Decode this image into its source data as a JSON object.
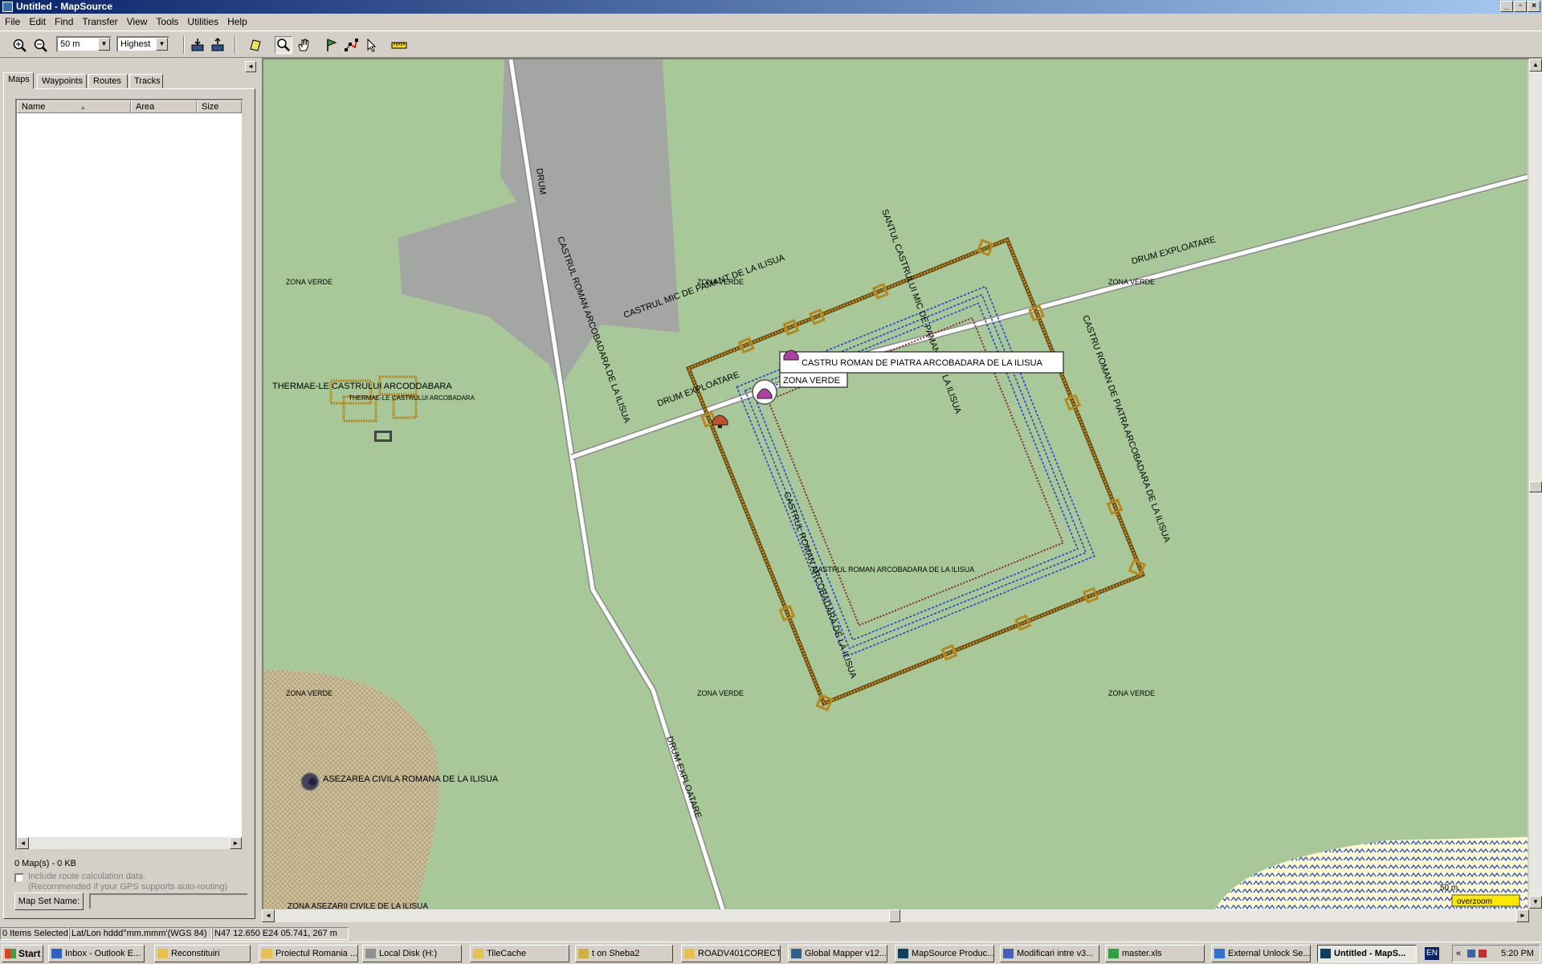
{
  "window": {
    "title": "Untitled - MapSource"
  },
  "menu": [
    "File",
    "Edit",
    "Find",
    "Transfer",
    "View",
    "Tools",
    "Utilities",
    "Help"
  ],
  "toolbar": {
    "zoom_value": "50 m",
    "detail_value": "Highest"
  },
  "sidebar": {
    "tabs": [
      "Maps",
      "Waypoints",
      "Routes",
      "Tracks"
    ],
    "columns": [
      "Name",
      "Area",
      "Size"
    ],
    "map_count": "0 Map(s) - 0 KB",
    "route_calc_label": "Include route calculation data.",
    "route_calc_note": "(Recommended if your GPS supports auto-routing)",
    "map_set_button": "Map Set Name:"
  },
  "map": {
    "road_labels": {
      "drum": "DRUM",
      "drum_exploatare": "DRUM EXPLOATARE"
    },
    "zone_label": "ZONA VERDE",
    "labels": {
      "castru_pamant": "CASTRUL MIC DE PAMANT DE LA ILISUA",
      "castru_roman": "CASTRUL ROMAN ARCOBADARA DE LA ILISUA",
      "castru_roman_small": "CASTRUL ROMAN ARCOBADARA DE LA ILISUA",
      "santul": "SANTUL CASTRULUI MIC DE PAMANT DE LA ILISUA",
      "castru_piatra": "CASTRU ROMAN DE PIATRA ARCOBADARA DE LA ILISUA",
      "thermae": "THERMAE-LE CASTRULUI ARCODDABARA",
      "thermae_small": "THERMAE-LE CASTRULUI ARCOBADARA",
      "asezarea": "ASEZAREA CIVILA ROMANA DE LA ILISUA",
      "asezarea_bottom": "ZONA ASEZARII CIVILE DE LA ILISUA"
    },
    "tooltip": {
      "title": "CASTRU ROMAN DE PIATRA ARCOBADARA DE LA ILISUA",
      "subtitle": "ZONA VERDE"
    },
    "scale": {
      "label": "50 m",
      "overzoom": "overzoom"
    },
    "colors": {
      "land": "#a8c89a",
      "building": "#a3a6a3",
      "road_fill": "#ffffff",
      "road_casing": "#8a8a8a",
      "wall": "#b5891f",
      "trench": "#2244cc",
      "earthwork": "#8a2a2a"
    }
  },
  "status": {
    "selected": "0 Items Selected",
    "format": "Lat/Lon hddd°mm.mmm'(WGS 84)",
    "coords": "N47 12.650 E24 05.741, 267 m"
  },
  "taskbar": {
    "start": "Start",
    "tasks": [
      "Inbox - Outlook E...",
      "Reconstituiri",
      "Proiectul Romania ...",
      "Local Disk (H:)",
      "TileCache",
      "t on Sheba2",
      "ROADV401CORECT",
      "Global Mapper v12...",
      "MapSource Produc...",
      "Modificari intre v3...",
      "master.xls",
      "External Unlock Se...",
      "Untitled - MapS..."
    ],
    "lang": "EN",
    "clock": "5:20 PM"
  }
}
